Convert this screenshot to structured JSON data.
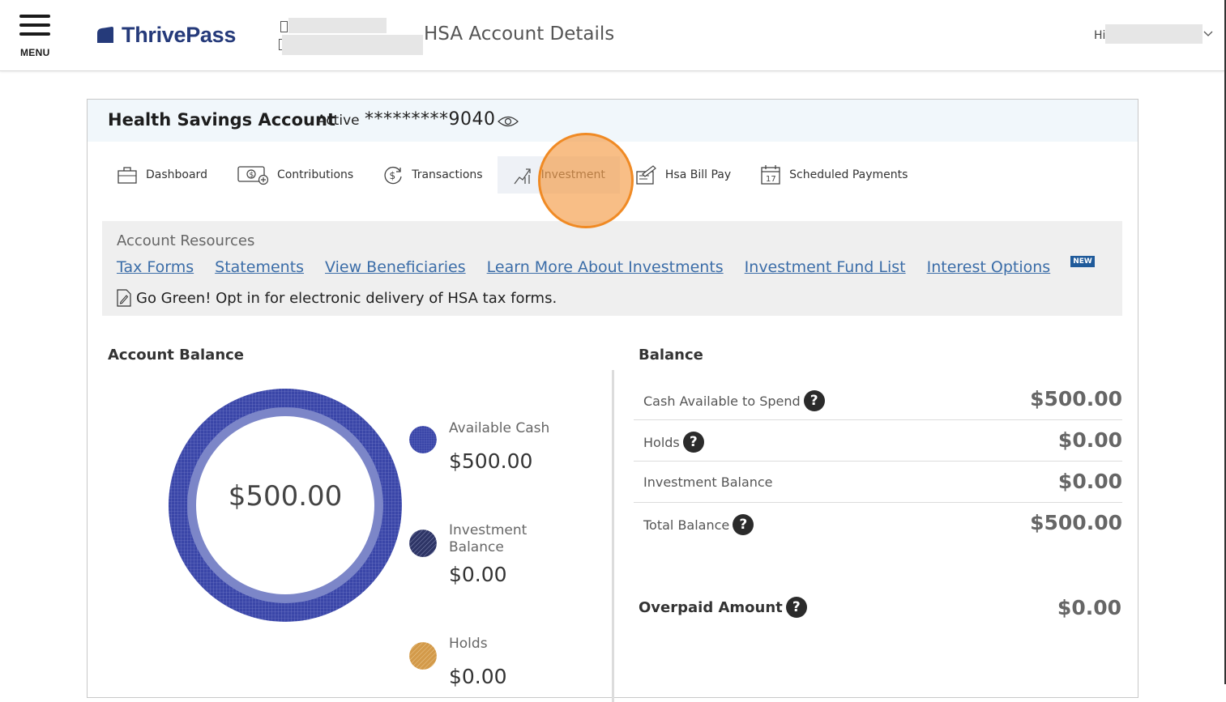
{
  "header": {
    "menu_label": "MENU",
    "logo_text": "ThrivePass",
    "page_title": "HSA Account Details",
    "greeting": "Hi"
  },
  "account": {
    "name": "Health Savings Account",
    "status": "Active",
    "masked_number": "*********9040"
  },
  "tabs": [
    {
      "label": "Dashboard",
      "icon": "briefcase-icon"
    },
    {
      "label": "Contributions",
      "icon": "money-add-icon"
    },
    {
      "label": "Transactions",
      "icon": "dollar-cycle-icon"
    },
    {
      "label": "Investment",
      "icon": "growth-chart-icon",
      "active": true
    },
    {
      "label": "Hsa Bill Pay",
      "icon": "bill-pay-icon"
    },
    {
      "label": "Scheduled Payments",
      "icon": "calendar-icon",
      "calendar_day": "17"
    }
  ],
  "resources": {
    "title": "Account Resources",
    "links": [
      "Tax Forms",
      "Statements",
      "View Beneficiaries",
      "Learn More About Investments",
      "Investment Fund List",
      "Interest Options"
    ],
    "new_badge": "NEW",
    "go_green": "Go Green! Opt in for electronic delivery of HSA tax forms."
  },
  "account_balance": {
    "title": "Account Balance",
    "total": "$500.00",
    "legend": [
      {
        "label": "Available Cash",
        "amount": "$500.00",
        "color": "#3a46a8"
      },
      {
        "label": "Investment Balance",
        "amount": "$0.00",
        "color": "#2e3566"
      },
      {
        "label": "Holds",
        "amount": "$0.00",
        "color": "#d39a4a"
      }
    ]
  },
  "balance": {
    "title": "Balance",
    "rows": [
      {
        "label": "Cash Available to Spend",
        "amount": "$500.00",
        "help": true
      },
      {
        "label": "Holds",
        "amount": "$0.00",
        "help": true
      },
      {
        "label": "Investment Balance",
        "amount": "$0.00",
        "help": false
      },
      {
        "label": "Total Balance",
        "amount": "$500.00",
        "help": true
      }
    ],
    "overpaid_label": "Overpaid Amount",
    "overpaid_amount": "$0.00",
    "help_glyph": "?"
  }
}
